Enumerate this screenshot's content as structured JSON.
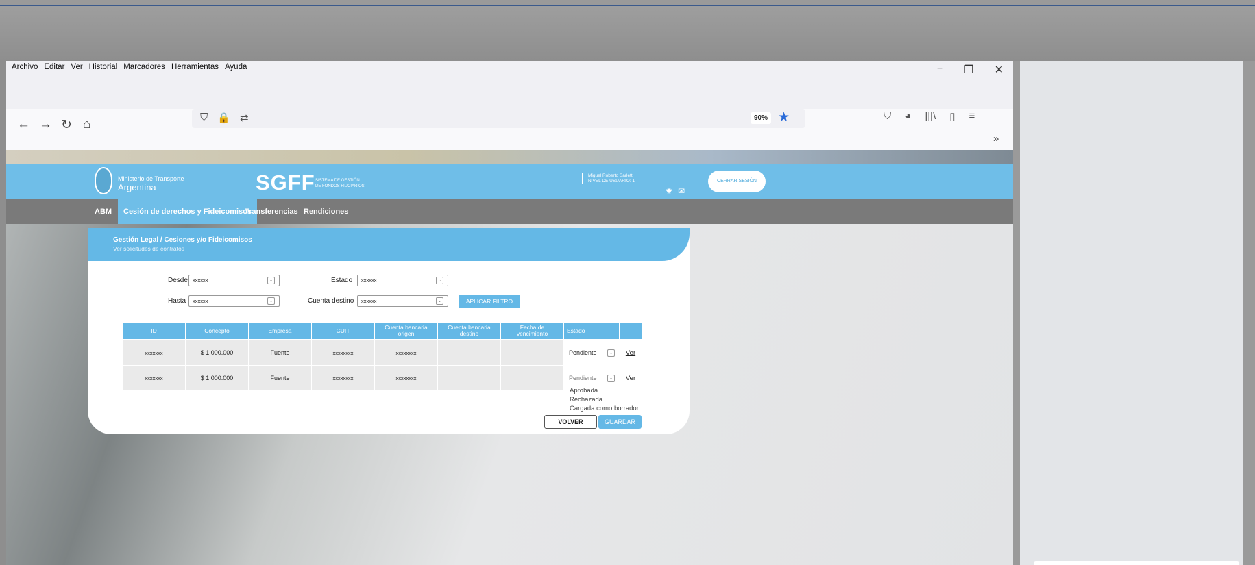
{
  "menubar": {
    "items": [
      "Archivo",
      "Editar",
      "Ver",
      "Historial",
      "Marcadores",
      "Herramientas",
      "Ayuda"
    ],
    "win_minimize": "−",
    "win_restore": "❐",
    "win_close": "✕"
  },
  "navbar": {
    "back": "←",
    "forward": "→",
    "reload": "↻",
    "home": "⌂",
    "url_icons": [
      "⛉",
      "🔒",
      "⇄"
    ],
    "zoom": "90%",
    "star": "★",
    "toolbar_icons": [
      "⛉",
      "◕",
      "|||\\",
      "▯",
      "≡"
    ],
    "overflow": "»"
  },
  "site": {
    "ministry_line1": "Ministerio de Transporte",
    "ministry_line2": "Argentina",
    "logo": "SGFF",
    "logo_sub1": "SISTEMA DE GESTIÓN",
    "logo_sub2": "DE FONDOS FIUCIARIOS",
    "user_name": "Miguel Roberto Sarletti",
    "user_level": "NIVEL DE USUARIO: 1",
    "logout": "CERRAR SESIÓN",
    "nav": [
      "ABM",
      "Cesión de derechos y Fideicomisos",
      "Transferencias",
      "Rendiciones"
    ]
  },
  "card": {
    "title": "Gestión Legal / Cesiones y/o Fideicomisos",
    "subtitle": "Ver solicitudes de contratos",
    "filters": {
      "desde_label": "Desde",
      "desde_value": "xxxxxx",
      "hasta_label": "Hasta",
      "hasta_value": "xxxxxx",
      "estado_label": "Estado",
      "estado_value": "xxxxxx",
      "cuenta_label": "Cuenta destino",
      "cuenta_value": "xxxxxx",
      "apply": "APLICAR FILTRO"
    },
    "table": {
      "headers": [
        "ID",
        "Concepto",
        "Empresa",
        "CUIT",
        "Cuenta bancaria origen",
        "Cuenta bancaria destino",
        "Fecha de vencimiento",
        "Estado",
        ""
      ],
      "rows": [
        {
          "id": "xxxxxxx",
          "concepto": "$ 1.000.000",
          "empresa": "Fuente",
          "cuit": "xxxxxxxx",
          "origen": "xxxxxxxx",
          "destino": "",
          "fecha": "",
          "estado": "Pendiente",
          "accion": "Ver"
        },
        {
          "id": "xxxxxxx",
          "concepto": "$ 1.000.000",
          "empresa": "Fuente",
          "cuit": "xxxxxxxx",
          "origen": "xxxxxxxx",
          "destino": "",
          "fecha": "",
          "estado": "Pendiente",
          "accion": "Ver"
        }
      ],
      "dropdown_options": [
        "Aprobada",
        "Rechazada",
        "Cargada como borrador"
      ]
    },
    "back": "VOLVER",
    "save": "GUARDAR"
  },
  "colors": {
    "accent": "#64b8e6",
    "nav_bg": "#7a7a7a"
  }
}
